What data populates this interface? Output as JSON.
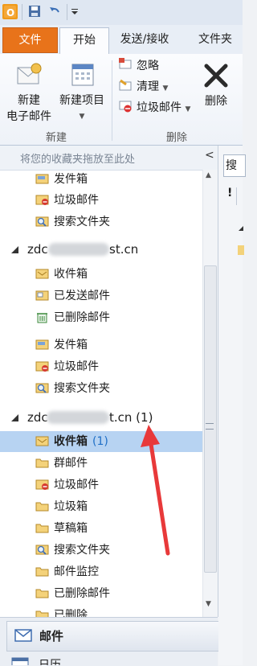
{
  "ribbon": {
    "tabs": [
      "文件",
      "开始",
      "发送/接收",
      "文件夹"
    ],
    "new_email": [
      "新建",
      "电子邮件"
    ],
    "new_items": "新建项目",
    "ignore": "忽略",
    "cleanup": "清理",
    "junk": "垃圾邮件",
    "delete": "删除",
    "group_new": "新建",
    "group_delete": "删除"
  },
  "folder_pane": {
    "favorites_hint": "将您的收藏夹拖放至此处",
    "collapse": "<",
    "favorites": [
      {
        "label": "发件箱",
        "icon": "outbox-icon"
      },
      {
        "label": "垃圾邮件",
        "icon": "junk-icon"
      },
      {
        "label": "搜索文件夹",
        "icon": "search-folder-icon"
      }
    ],
    "account1": {
      "prefix": "zdc",
      "suffix": "st.cn",
      "folders": [
        {
          "label": "收件箱",
          "icon": "inbox-icon"
        },
        {
          "label": "已发送邮件",
          "icon": "sent-icon"
        },
        {
          "label": "已删除邮件",
          "icon": "deleted-icon"
        },
        {
          "label": "发件箱",
          "icon": "outbox-icon"
        },
        {
          "label": "垃圾邮件",
          "icon": "junk-icon"
        },
        {
          "label": "搜索文件夹",
          "icon": "search-folder-icon"
        }
      ]
    },
    "account2": {
      "prefix": "zdc",
      "suffix": "t.cn (1)",
      "folders": [
        {
          "label": "收件箱",
          "count": "(1)",
          "icon": "inbox-icon",
          "selected": true
        },
        {
          "label": "群邮件",
          "icon": "folder-icon"
        },
        {
          "label": "垃圾邮件",
          "icon": "junk-icon"
        },
        {
          "label": "垃圾箱",
          "icon": "folder-icon"
        },
        {
          "label": "草稿箱",
          "icon": "folder-icon"
        },
        {
          "label": "搜索文件夹",
          "icon": "search-folder-icon"
        },
        {
          "label": "邮件监控",
          "icon": "folder-icon"
        },
        {
          "label": "已删除邮件",
          "icon": "folder-icon"
        },
        {
          "label": "已删除",
          "icon": "folder-icon"
        }
      ]
    }
  },
  "nav": {
    "mail": "邮件",
    "calendar": "日历"
  },
  "right_strip": {
    "search_prefix": "搜",
    "bang": "!"
  },
  "colors": {
    "file_tab": "#e8731a",
    "selection": "#b7d3f2",
    "annotation_arrow": "#e8393a",
    "count": "#1f6fc6"
  }
}
